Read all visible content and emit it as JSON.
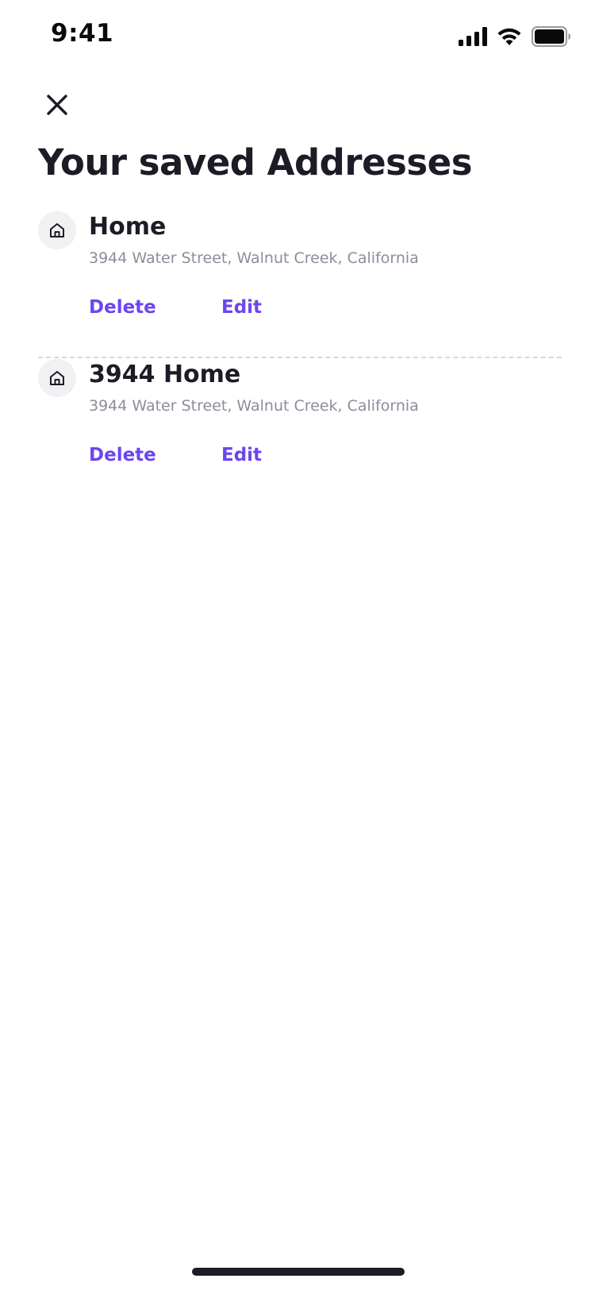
{
  "status_bar": {
    "time": "9:41",
    "icons": [
      "signal-icon",
      "wifi-icon",
      "battery-icon"
    ]
  },
  "header": {
    "close_icon": "close-icon",
    "title": "Your saved Addresses"
  },
  "addresses": [
    {
      "icon": "home-icon",
      "name": "Home",
      "address": "3944 Water Street, Walnut Creek, California",
      "delete_label": "Delete",
      "edit_label": "Edit"
    },
    {
      "icon": "home-icon",
      "name": "3944 Home",
      "address": "3944 Water Street, Walnut Creek, California",
      "delete_label": "Delete",
      "edit_label": "Edit"
    }
  ],
  "colors": {
    "accent": "#6c45f0",
    "text_primary": "#1c1b26",
    "text_secondary": "#8e8c9c",
    "icon_bg": "#f1f1f3"
  }
}
